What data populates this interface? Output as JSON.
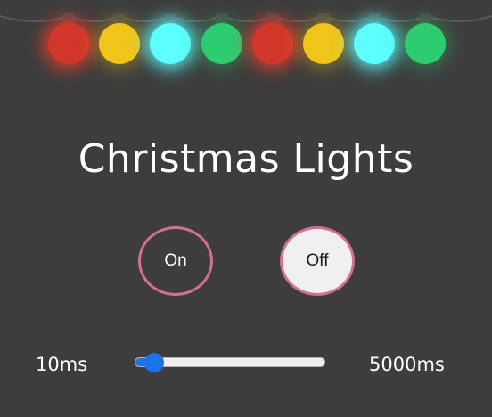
{
  "title": "Christmas Lights",
  "lights": [
    {
      "icon": "bulb-icon",
      "color": "#d2382a",
      "glow": "rgba(232,60,45,0.85)"
    },
    {
      "icon": "bulb-icon",
      "color": "#f0c419",
      "glow": "rgba(240,196,25,0.35)"
    },
    {
      "icon": "bulb-icon",
      "color": "#5cfdfd",
      "glow": "rgba(92,253,253,0.85)"
    },
    {
      "icon": "bulb-icon",
      "color": "#2ecc71",
      "glow": "rgba(46,204,113,0.35)"
    },
    {
      "icon": "bulb-icon",
      "color": "#d2382a",
      "glow": "rgba(232,60,45,0.85)"
    },
    {
      "icon": "bulb-icon",
      "color": "#f0c419",
      "glow": "rgba(240,196,25,0.35)"
    },
    {
      "icon": "bulb-icon",
      "color": "#5cfdfd",
      "glow": "rgba(92,253,253,0.85)"
    },
    {
      "icon": "bulb-icon",
      "color": "#2ecc71",
      "glow": "rgba(46,204,113,0.35)"
    }
  ],
  "controls": {
    "on_label": "On",
    "off_label": "Off",
    "button_border_color": "#d36f95"
  },
  "speed": {
    "min_label": "10ms",
    "max_label": "5000ms",
    "min": 10,
    "max": 5000,
    "value": 290,
    "accent_color": "#1a73e8"
  },
  "colors": {
    "background": "#3d3d3d",
    "text": "#ffffff",
    "wire": "#5a5a5a"
  }
}
